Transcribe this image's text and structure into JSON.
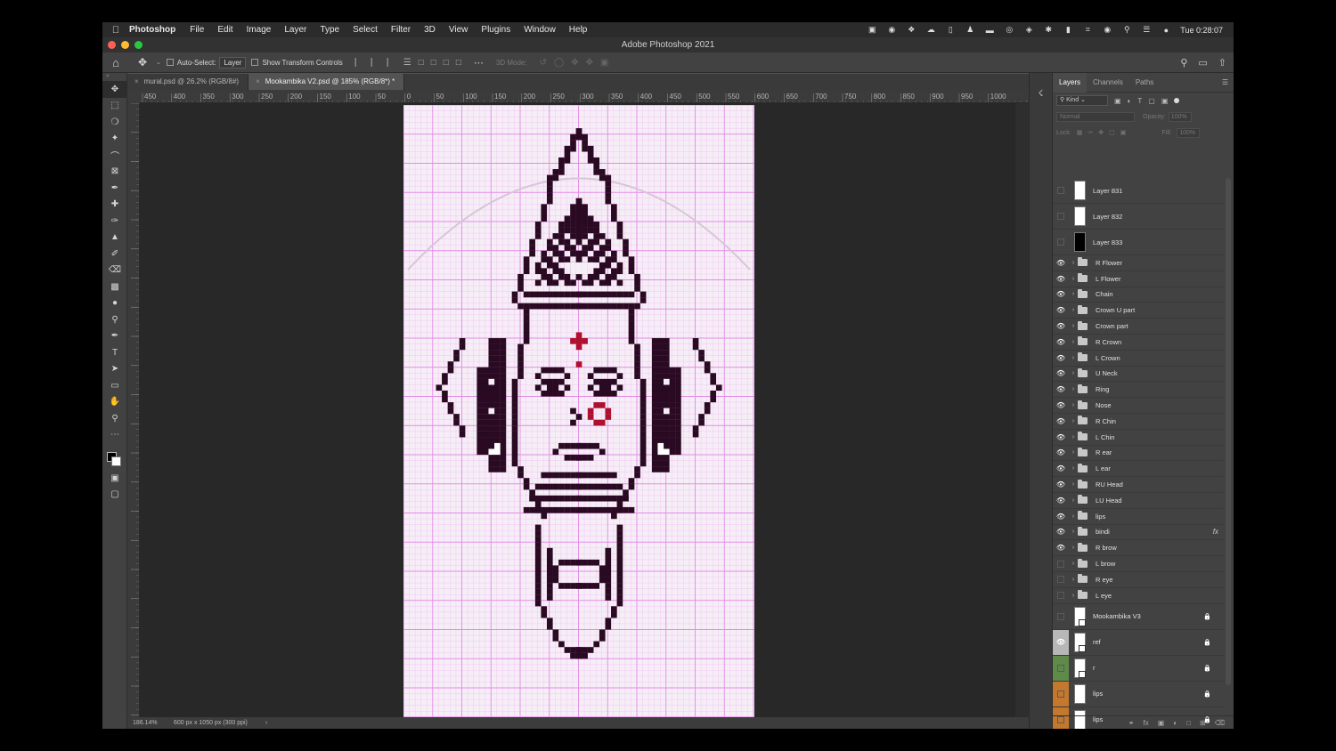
{
  "menubar": {
    "app_name": "Photoshop",
    "menus": [
      "File",
      "Edit",
      "Image",
      "Layer",
      "Type",
      "Select",
      "Filter",
      "3D",
      "View",
      "Plugins",
      "Window",
      "Help"
    ],
    "clock": "Tue 0:28:07"
  },
  "window": {
    "title": "Adobe Photoshop 2021"
  },
  "options": {
    "auto_select_label": "Auto-Select:",
    "auto_select_value": "Layer",
    "transform_label": "Show Transform Controls",
    "mode_3d_label": "3D Mode:"
  },
  "tabs": [
    {
      "label": "mural.psd @ 26.2% (RGB/8#)"
    },
    {
      "label": "Mookambika V2.psd @ 185% (RGB/8*) *"
    }
  ],
  "ruler": {
    "h_labels": [
      "450",
      "400",
      "350",
      "300",
      "250",
      "200",
      "150",
      "100",
      "50",
      "0",
      "50",
      "100",
      "150",
      "200",
      "250",
      "300",
      "350",
      "400",
      "450",
      "500",
      "550",
      "600",
      "650",
      "700",
      "750",
      "800",
      "850",
      "900",
      "950",
      "1000"
    ]
  },
  "status": {
    "zoom": "186.14%",
    "doc_size": "600 px x 1050 px (300 ppi)"
  },
  "panel": {
    "tabs": [
      "Layers",
      "Channels",
      "Paths"
    ],
    "filter_kind": "Kind",
    "blend_mode": "Normal",
    "opacity_label": "Opacity:",
    "opacity_value": "100%",
    "lock_label": "Lock:",
    "fill_label": "Fill:",
    "fill_value": "100%"
  },
  "layers": [
    {
      "name": "Layer 831",
      "kind": "pixel",
      "visible": false
    },
    {
      "name": "Layer 832",
      "kind": "pixel",
      "visible": false
    },
    {
      "name": "Layer 833",
      "kind": "pixel-dark",
      "visible": false
    },
    {
      "name": "R Flower",
      "kind": "group",
      "visible": true
    },
    {
      "name": "L Flower",
      "kind": "group",
      "visible": true
    },
    {
      "name": "Chain",
      "kind": "group",
      "visible": true
    },
    {
      "name": "Crown U part",
      "kind": "group",
      "visible": true
    },
    {
      "name": "Crown part",
      "kind": "group",
      "visible": true
    },
    {
      "name": "R Crown",
      "kind": "group",
      "visible": true
    },
    {
      "name": "L Crown",
      "kind": "group",
      "visible": true
    },
    {
      "name": "U Neck",
      "kind": "group",
      "visible": true
    },
    {
      "name": "Ring",
      "kind": "group",
      "visible": true
    },
    {
      "name": "Nose",
      "kind": "group",
      "visible": true
    },
    {
      "name": "R Chin",
      "kind": "group",
      "visible": true
    },
    {
      "name": "L Chin",
      "kind": "group",
      "visible": true
    },
    {
      "name": "R ear",
      "kind": "group",
      "visible": true
    },
    {
      "name": "L ear",
      "kind": "group",
      "visible": true
    },
    {
      "name": "RU Head",
      "kind": "group",
      "visible": true
    },
    {
      "name": "LU Head",
      "kind": "group",
      "visible": true
    },
    {
      "name": "lips",
      "kind": "group",
      "visible": true
    },
    {
      "name": "bindi",
      "kind": "group",
      "visible": true,
      "fx": "fx"
    },
    {
      "name": "R brow",
      "kind": "group",
      "visible": true
    },
    {
      "name": "L brow",
      "kind": "group",
      "visible": false
    },
    {
      "name": "R eye",
      "kind": "group",
      "visible": false
    },
    {
      "name": "L eye",
      "kind": "group",
      "visible": false
    },
    {
      "name": "Mookambika V3",
      "kind": "ref",
      "visible": false,
      "locked": true
    },
    {
      "name": "ref",
      "kind": "ref",
      "visible": true,
      "locked": true,
      "color": "blue"
    },
    {
      "name": "r",
      "kind": "ref",
      "visible": false,
      "locked": true,
      "color": "green"
    },
    {
      "name": "lips",
      "kind": "pixel",
      "visible": false,
      "locked": true,
      "color": "orange"
    },
    {
      "name": "lips",
      "kind": "pixel",
      "visible": false,
      "locked": true,
      "color": "orange"
    }
  ],
  "colors": {
    "grid": "#e38be8",
    "grid_fine": "#f0c8f2",
    "ink": "#2a0a22",
    "accent": "#b01030",
    "artboard": "#f6eef6"
  }
}
